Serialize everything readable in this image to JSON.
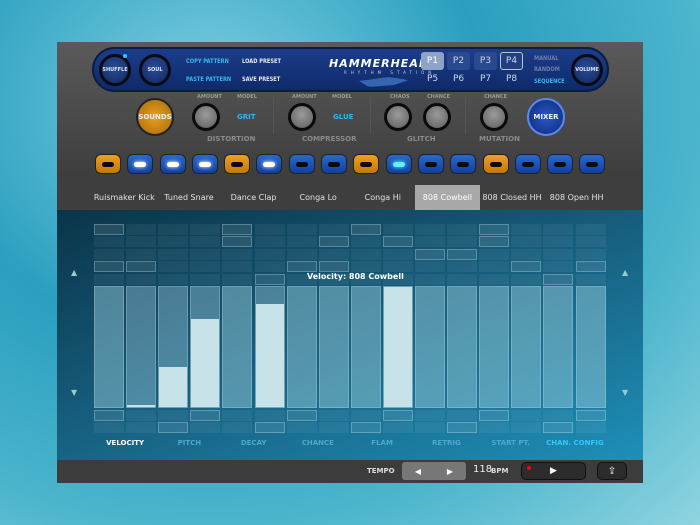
{
  "header": {
    "shuffle": "SHUFFLE",
    "soul": "SOUL",
    "copy_pattern": "COPY PATTERN",
    "paste_pattern": "PASTE PATTERN",
    "load_preset": "LOAD PRESET",
    "save_preset": "SAVE PRESET",
    "logo": "HAMMERHEAD",
    "logo_sub": "RHYTHM STATION",
    "patterns": [
      "P1",
      "P2",
      "P3",
      "P4",
      "P5",
      "P6",
      "P7",
      "P8"
    ],
    "selected_pattern": "P1",
    "modes": [
      "MANUAL",
      "RANDOM",
      "SEQUENCE"
    ],
    "active_mode": "SEQUENCE",
    "volume": "VOLUME"
  },
  "effects": {
    "sounds": "SOUNDS",
    "mixer": "MIXER",
    "distortion": {
      "label": "DISTORTION",
      "amount": "AMOUNT",
      "model": "MODEL",
      "model_value": "GRIT"
    },
    "compressor": {
      "label": "COMPRESSOR",
      "amount": "AMOUNT",
      "model": "MODEL",
      "model_value": "GLUE"
    },
    "glitch": {
      "label": "GLITCH",
      "chaos": "CHAOS",
      "chance": "CHANCE"
    },
    "mutation": {
      "label": "MUTATION",
      "chance": "CHANCE"
    }
  },
  "steps": [
    "orange",
    "white",
    "white",
    "white",
    "orange",
    "white",
    "off",
    "off",
    "orange",
    "cyan",
    "off",
    "off",
    "orange",
    "off",
    "off",
    "off"
  ],
  "tracks": [
    "Ruismaker Kick",
    "Tuned Snare",
    "Dance Clap",
    "Conga Lo",
    "Conga Hi",
    "808 Cowbell",
    "808 Closed HH",
    "808 Open HH"
  ],
  "selected_track": "808 Cowbell",
  "editor": {
    "label": "Velocity: 808 Cowbell",
    "velocities": [
      1.0,
      0.02,
      0.33,
      0.73,
      1.0,
      0.86,
      1.0,
      1.0,
      1.0,
      1.0,
      1.0,
      1.0,
      1.0,
      1.0,
      1.0,
      1.0
    ],
    "active": [
      false,
      true,
      true,
      true,
      false,
      true,
      false,
      false,
      false,
      true,
      false,
      false,
      false,
      false,
      false,
      false
    ]
  },
  "params": [
    "VELOCITY",
    "PITCH",
    "DECAY",
    "CHANCE",
    "FLAM",
    "RETRIG",
    "START PT.",
    "CHAN. CONFIG"
  ],
  "selected_param": "VELOCITY",
  "transport": {
    "tempo_label": "TEMPO",
    "bpm": "118",
    "bpm_label": "BPM",
    "prev": "◀",
    "next": "▶",
    "play": "▶",
    "share": "⇪"
  }
}
